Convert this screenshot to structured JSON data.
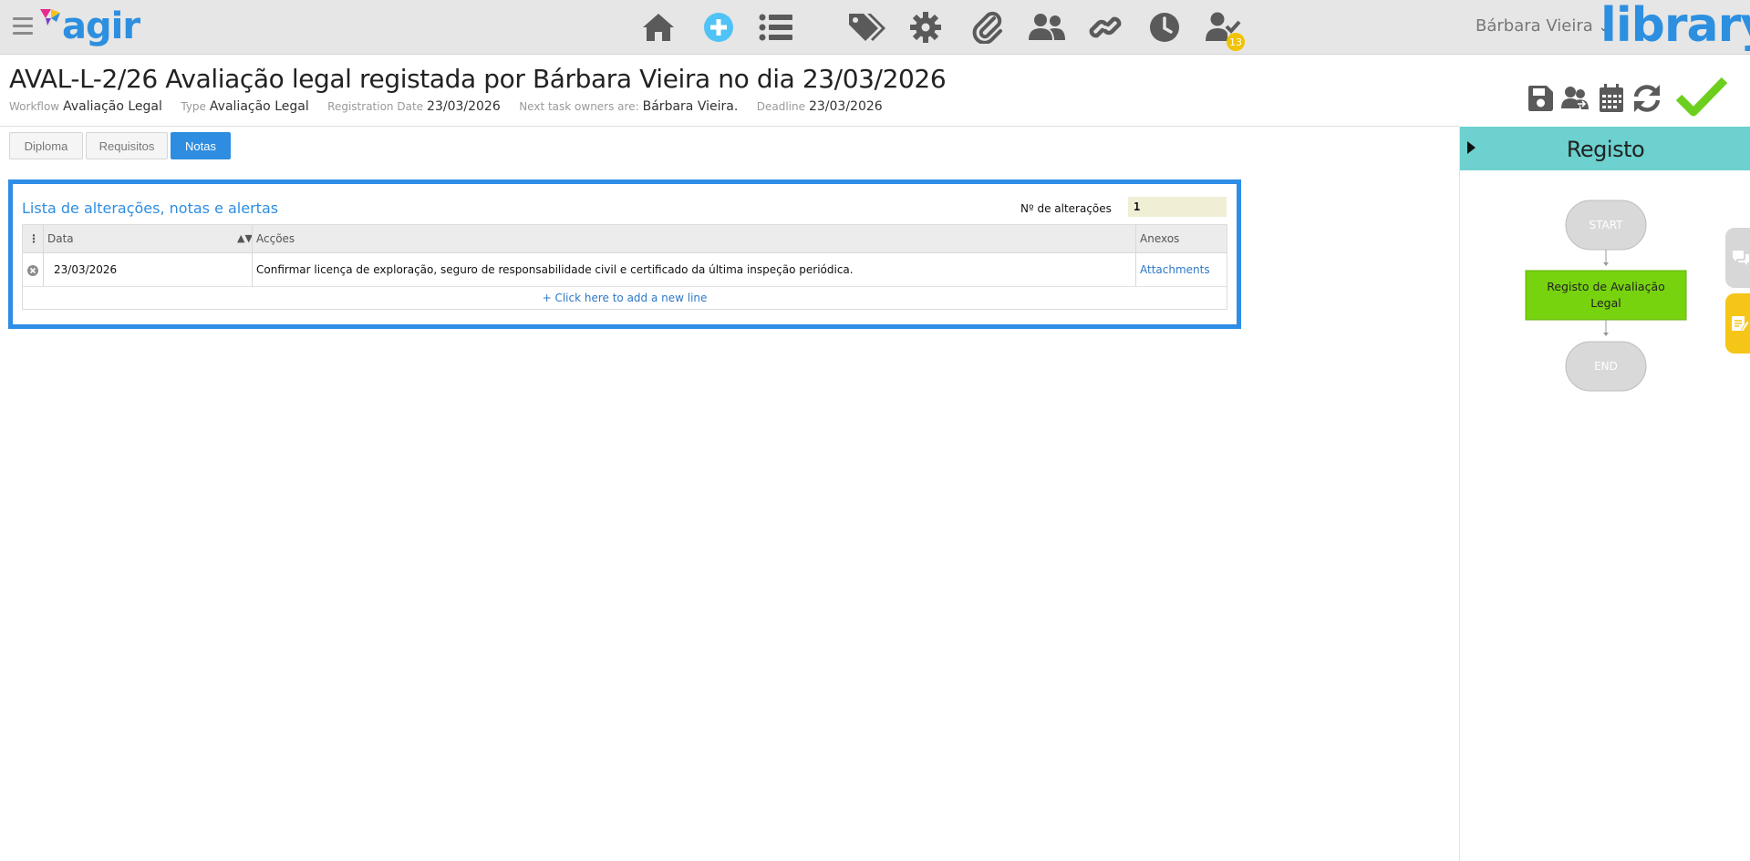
{
  "topbar": {
    "logo_text": "agir",
    "user_name": "Bárbara Vieira",
    "brand": "library",
    "nav_icons": [
      "home-icon",
      "add-icon",
      "list-icon",
      "tags-icon",
      "settings-icon",
      "attachment-icon",
      "users-icon",
      "link-icon",
      "clock-icon",
      "user-tasks-icon"
    ],
    "tasks_badge": "13",
    "colors": {
      "bar_bg": "#e6e6e6",
      "icon": "#5a5a5a",
      "add_icon": "#4fc3f7",
      "brand": "#2d8fe0"
    }
  },
  "header": {
    "title": "AVAL-L-2/26 Avaliação legal registada por Bárbara Vieira no dia 23/03/2026",
    "meta": {
      "workflow_label": "Workflow",
      "workflow_value": "Avaliação Legal",
      "type_label": "Type",
      "type_value": "Avaliação Legal",
      "registration_label": "Registration Date",
      "registration_value": "23/03/2026",
      "owners_label": "Next task owners are:",
      "owners_value": "Bárbara Vieira.",
      "deadline_label": "Deadline",
      "deadline_value": "23/03/2026"
    },
    "actions": [
      "save-icon",
      "reassign-icon",
      "calendar-icon",
      "refresh-icon",
      "approve-check-icon"
    ],
    "colors": {
      "approve": "#6ccf1e"
    }
  },
  "tabs": [
    {
      "label": "Diploma",
      "active": false
    },
    {
      "label": "Requisitos",
      "active": false
    },
    {
      "label": "Notas",
      "active": true
    }
  ],
  "notes": {
    "title": "Lista de alterações, notas e alertas",
    "count_label": "Nº de alterações",
    "count_value": "1",
    "columns": [
      "Data",
      "Acções",
      "Anexos"
    ],
    "rows": [
      {
        "date": "23/03/2026",
        "action": "Confirmar licença de exploração, seguro de responsabilidade civil e certificado da última inspeção periódica.",
        "attachments": "Attachments"
      }
    ],
    "add_line": "+ Click here to add a new line",
    "colors": {
      "border": "#2e8de6",
      "title": "#2e8de0"
    }
  },
  "side_panel": {
    "title": "Registo",
    "workflow": {
      "start": "START",
      "task_line1": "Registo de Avaliação",
      "task_line2": "Legal",
      "end": "END"
    },
    "colors": {
      "header": "#6cd1cf",
      "task": "#77d30e",
      "node": "#d9d9d9"
    }
  },
  "edge_tabs": [
    "chat-icon",
    "notes-icon"
  ]
}
